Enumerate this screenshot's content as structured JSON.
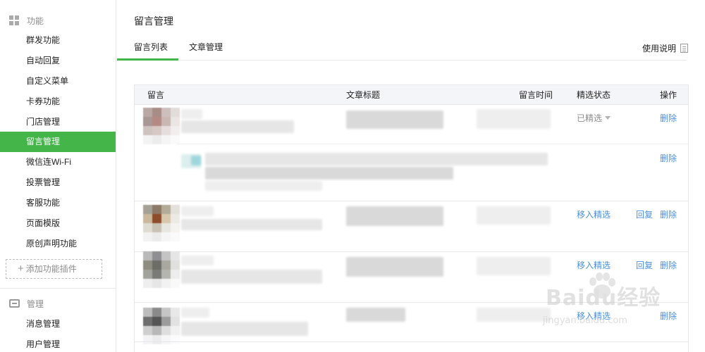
{
  "sidebar": {
    "section_features": {
      "label": "功能",
      "icon": "grid-icon"
    },
    "feature_items": [
      {
        "label": "群发功能"
      },
      {
        "label": "自动回复"
      },
      {
        "label": "自定义菜单"
      },
      {
        "label": "卡券功能"
      },
      {
        "label": "门店管理"
      },
      {
        "label": "留言管理"
      },
      {
        "label": "微信连Wi-Fi"
      },
      {
        "label": "投票管理"
      },
      {
        "label": "客服功能"
      },
      {
        "label": "页面模版"
      },
      {
        "label": "原创声明功能"
      }
    ],
    "add_plugin": {
      "label": "添加功能插件",
      "icon": "plus-icon"
    },
    "section_manage": {
      "label": "管理",
      "icon": "inbox-icon"
    },
    "manage_items": [
      {
        "label": "消息管理"
      },
      {
        "label": "用户管理"
      }
    ],
    "active_color": "#44b549"
  },
  "main": {
    "title": "留言管理",
    "tabs": [
      {
        "label": "留言列表",
        "active": true
      },
      {
        "label": "文章管理",
        "active": false
      }
    ],
    "help": {
      "label": "使用说明",
      "icon": "document-icon"
    }
  },
  "table": {
    "headers": {
      "comment": "留言",
      "article_title": "文章标题",
      "time": "留言时间",
      "status": "精选状态",
      "actions": "操作"
    },
    "rows": [
      {
        "status": "已精选",
        "actions": [
          "删除"
        ],
        "reply_actions": [
          "删除"
        ]
      },
      {
        "status": "移入精选",
        "actions": [
          "回复",
          "删除"
        ]
      },
      {
        "status": "移入精选",
        "actions": [
          "回复",
          "删除"
        ]
      },
      {
        "status": "移入精选",
        "actions": [
          "删除"
        ]
      }
    ],
    "link_color": "#4a90e2"
  },
  "watermark": {
    "text": "Baidu经验",
    "url": "jingyan.baidu.com"
  }
}
